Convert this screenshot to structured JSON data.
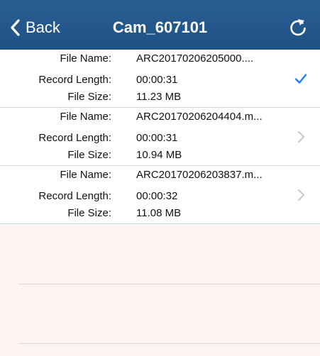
{
  "navbar": {
    "back_label": "Back",
    "title": "Cam_607101",
    "refresh_icon": "refresh-icon",
    "background": "#235789"
  },
  "labels": {
    "file_name": "File Name:",
    "record_length": "Record Length:",
    "file_size": "File Size:"
  },
  "files": [
    {
      "file_name": "ARC20170206205000....",
      "record_length": "00:00:31",
      "file_size": "11.23 MB",
      "accessory": "checkmark-icon",
      "selected": true
    },
    {
      "file_name": "ARC20170206204404.m...",
      "record_length": "00:00:31",
      "file_size": "10.94 MB",
      "accessory": "chevron-right-icon",
      "selected": false
    },
    {
      "file_name": "ARC20170206203837.m...",
      "record_length": "00:00:32",
      "file_size": "11.08 MB",
      "accessory": "chevron-right-icon",
      "selected": false
    }
  ],
  "colors": {
    "accent": "#1a7ff0",
    "chevron": "#c7c7cc",
    "empty_background": "#fdf3f3"
  }
}
